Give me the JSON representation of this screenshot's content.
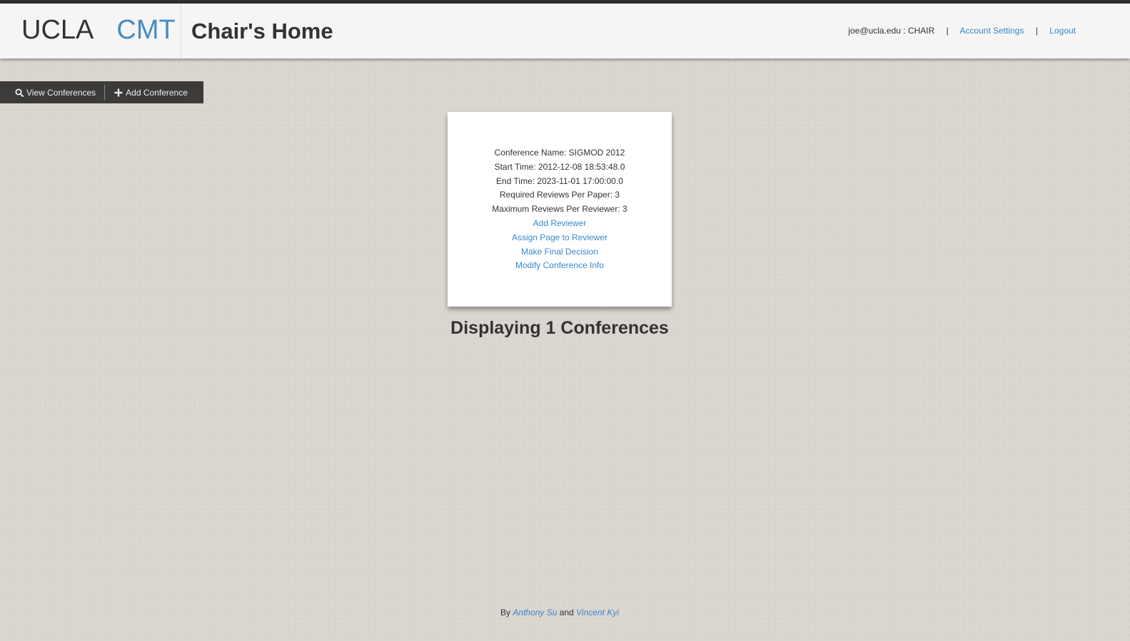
{
  "header": {
    "brand_left": "UCLA",
    "brand_right": "CMT",
    "page_title": "Chair's Home",
    "user_label": "joe@ucla.edu : CHAIR",
    "separator": "|",
    "account_settings": "Account Settings",
    "logout": "Logout"
  },
  "toolbar": {
    "view_label": "View Conferences",
    "view_icon": "search-icon",
    "add_label": "Add Conference",
    "add_icon": "plus-icon"
  },
  "conference": {
    "name": "Conference Name: SIGMOD 2012",
    "start": "Start Time: 2012-12-08 18:53:48.0",
    "end": "End Time: 2023-11-01 17:00:00.0",
    "required_reviews": "Required Reviews Per Paper: 3",
    "max_reviews": "Maximum Reviews Per Reviewer: 3",
    "links": {
      "add_reviewer": "Add Reviewer",
      "assign_page": "Assign Page to Reviewer",
      "final_decision": "Make Final Decision",
      "modify_info": "Modify Conference Info"
    }
  },
  "main": {
    "display_count": "Displaying 1 Conferences"
  },
  "footer": {
    "by": "By",
    "author1": "Anthony Su",
    "and": "and",
    "author2": "Vincent Kyi"
  },
  "colors": {
    "accent": "#3a87c8",
    "brand_blue": "#4a8bc0",
    "toolbar": "#3c3b39",
    "background": "#d9d5cf"
  }
}
